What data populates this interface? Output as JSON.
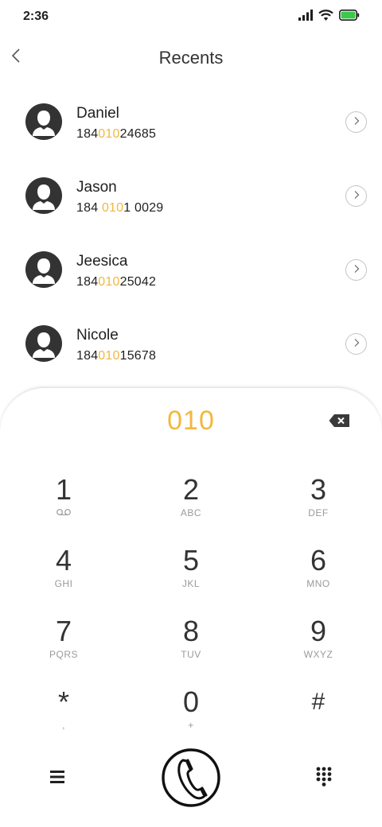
{
  "status_bar": {
    "time": "2:36",
    "icons": [
      "signal-icon",
      "wifi-icon",
      "battery-icon"
    ],
    "battery_color": "#3ac94a"
  },
  "header": {
    "back_icon": "chevron-left-icon",
    "title": "Recents"
  },
  "recents": [
    {
      "name": "Daniel",
      "number_pre": "184",
      "number_match": "010",
      "number_post": "24685"
    },
    {
      "name": "Jason",
      "number_pre": "184 ",
      "number_match": "010",
      "number_post": "1 0029"
    },
    {
      "name": "Jeesica",
      "number_pre": "184",
      "number_match": "010",
      "number_post": "25042"
    },
    {
      "name": "Nicole",
      "number_pre": "184",
      "number_match": "010",
      "number_post": "15678"
    }
  ],
  "dialpad": {
    "dialed": "010",
    "accent_color": "#f3b73f",
    "keys": [
      {
        "digit": "1",
        "letters": "",
        "sub_icon": "voicemail-icon"
      },
      {
        "digit": "2",
        "letters": "ABC"
      },
      {
        "digit": "3",
        "letters": "DEF"
      },
      {
        "digit": "4",
        "letters": "GHI"
      },
      {
        "digit": "5",
        "letters": "JKL"
      },
      {
        "digit": "6",
        "letters": "MNO"
      },
      {
        "digit": "7",
        "letters": "PQRS"
      },
      {
        "digit": "8",
        "letters": "TUV"
      },
      {
        "digit": "9",
        "letters": "WXYZ"
      },
      {
        "digit": "*",
        "letters": ","
      },
      {
        "digit": "0",
        "letters": "+"
      },
      {
        "digit": "#",
        "letters": ""
      }
    ],
    "bottom_icons": [
      "menu-icon",
      "phone-icon",
      "keypad-icon"
    ]
  }
}
